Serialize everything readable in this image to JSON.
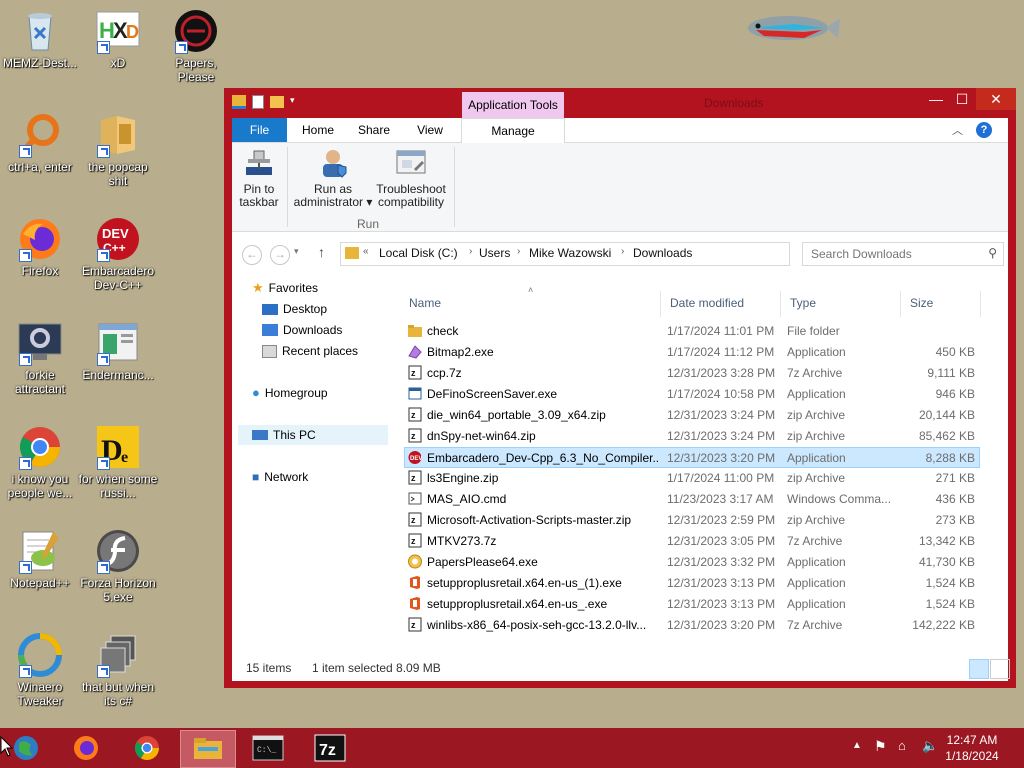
{
  "desktop": {
    "icons": [
      {
        "label": "MEMZ-Dest..."
      },
      {
        "label": "xD"
      },
      {
        "label": "Papers, Please"
      },
      {
        "label": "ctrl+a, enter"
      },
      {
        "label": "the popcap shit"
      },
      {
        "label": "Firefox"
      },
      {
        "label": "Embarcadero Dev-C++"
      },
      {
        "label": "forkie attractant"
      },
      {
        "label": "Endermanc..."
      },
      {
        "label": "i know you people we..."
      },
      {
        "label": "for when some russi..."
      },
      {
        "label": "Notepad++"
      },
      {
        "label": "Forza Horizon 5.exe"
      },
      {
        "label": "Winaero Tweaker"
      },
      {
        "label": "that but when its c#"
      }
    ]
  },
  "window": {
    "title": "Downloads",
    "context_tab": "Application Tools",
    "controls": {
      "minimize": "—",
      "maximize": "☐",
      "close": "✕"
    },
    "ribbon_tabs": [
      "File",
      "Home",
      "Share",
      "View",
      "Manage"
    ],
    "ribbon_buttons": [
      {
        "label1": "Pin to",
        "label2": "taskbar"
      },
      {
        "label1": "Run as",
        "label2": "administrator ▾"
      },
      {
        "label1": "Troubleshoot",
        "label2": "compatibility"
      }
    ],
    "group_label": "Run",
    "address": {
      "prefix": "«",
      "crumbs": [
        "Local Disk (C:)",
        "Users",
        "Mike Wazowski",
        "Downloads"
      ]
    },
    "search_placeholder": "Search Downloads",
    "nav": {
      "favorites": "Favorites",
      "desktop": "Desktop",
      "downloads": "Downloads",
      "recent": "Recent places",
      "homegroup": "Homegroup",
      "thispc": "This PC",
      "network": "Network"
    },
    "columns": {
      "name": "Name",
      "date": "Date modified",
      "type": "Type",
      "size": "Size"
    },
    "files": [
      {
        "name": "check",
        "date": "1/17/2024 11:01 PM",
        "type": "File folder",
        "size": "",
        "icon": "folder"
      },
      {
        "name": "Bitmap2.exe",
        "date": "1/17/2024 11:12 PM",
        "type": "Application",
        "size": "450 KB",
        "icon": "exe-purple"
      },
      {
        "name": "ccp.7z",
        "date": "12/31/2023 3:28 PM",
        "type": "7z Archive",
        "size": "9,111 KB",
        "icon": "archive"
      },
      {
        "name": "DeFinoScreenSaver.exe",
        "date": "1/17/2024 10:58 PM",
        "type": "Application",
        "size": "946 KB",
        "icon": "exe-window"
      },
      {
        "name": "die_win64_portable_3.09_x64.zip",
        "date": "12/31/2023 3:24 PM",
        "type": "zip Archive",
        "size": "20,144 KB",
        "icon": "archive"
      },
      {
        "name": "dnSpy-net-win64.zip",
        "date": "12/31/2023 3:24 PM",
        "type": "zip Archive",
        "size": "85,462 KB",
        "icon": "archive"
      },
      {
        "name": "Embarcadero_Dev-Cpp_6.3_No_Compiler...",
        "date": "12/31/2023 3:20 PM",
        "type": "Application",
        "size": "8,288 KB",
        "icon": "exe-red"
      },
      {
        "name": "ls3Engine.zip",
        "date": "1/17/2024 11:00 PM",
        "type": "zip Archive",
        "size": "271 KB",
        "icon": "archive"
      },
      {
        "name": "MAS_AIO.cmd",
        "date": "11/23/2023 3:17 AM",
        "type": "Windows Comma...",
        "size": "436 KB",
        "icon": "cmd"
      },
      {
        "name": "Microsoft-Activation-Scripts-master.zip",
        "date": "12/31/2023 2:59 PM",
        "type": "zip Archive",
        "size": "273 KB",
        "icon": "archive"
      },
      {
        "name": "MTKV273.7z",
        "date": "12/31/2023 3:05 PM",
        "type": "7z Archive",
        "size": "13,342 KB",
        "icon": "archive"
      },
      {
        "name": "PapersPlease64.exe",
        "date": "12/31/2023 3:32 PM",
        "type": "Application",
        "size": "41,730 KB",
        "icon": "exe-yellow"
      },
      {
        "name": "setupproplusretail.x64.en-us_(1).exe",
        "date": "12/31/2023 3:13 PM",
        "type": "Application",
        "size": "1,524 KB",
        "icon": "office"
      },
      {
        "name": "setupproplusretail.x64.en-us_.exe",
        "date": "12/31/2023 3:13 PM",
        "type": "Application",
        "size": "1,524 KB",
        "icon": "office"
      },
      {
        "name": "winlibs-x86_64-posix-seh-gcc-13.2.0-llv...",
        "date": "12/31/2023 3:20 PM",
        "type": "7z Archive",
        "size": "142,222 KB",
        "icon": "archive"
      }
    ],
    "selected_index": 6,
    "status": {
      "count": "15 items",
      "selection": "1 item selected  8.09 MB"
    }
  },
  "taskbar": {
    "clock_time": "12:47 AM",
    "clock_date": "1/18/2024",
    "tray_arrow": "▲",
    "accent": "#9b1722"
  }
}
